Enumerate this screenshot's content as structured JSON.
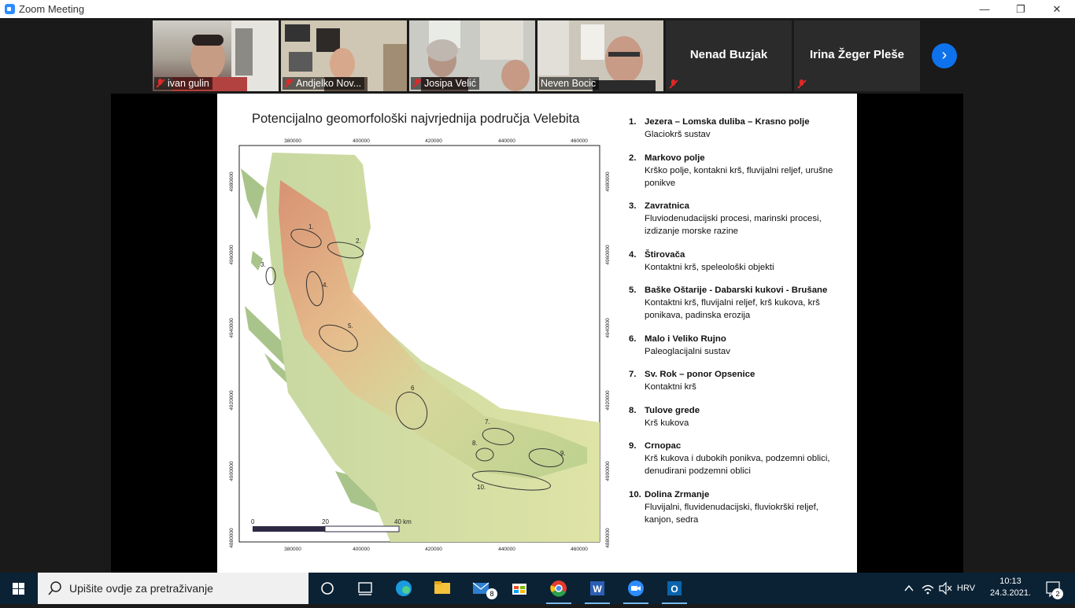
{
  "window": {
    "title": "Zoom Meeting",
    "minimize": "—",
    "restore": "❐",
    "close": "✕"
  },
  "participants": [
    {
      "name": "ivan gulin"
    },
    {
      "name": "Andjelko Nov..."
    },
    {
      "name": "Josipa Velić"
    },
    {
      "name": "Neven Bocic"
    },
    {
      "name": "Nenad Buzjak"
    },
    {
      "name": "Irina Žeger Pleše"
    }
  ],
  "next_page_glyph": "›",
  "slide": {
    "title": "Potencijalno geomorfološki najvrjednija područja Velebita",
    "map": {
      "x_ticks": [
        "380000",
        "400000",
        "420000",
        "440000",
        "460000"
      ],
      "y_ticks": [
        "4980000",
        "4960000",
        "4940000",
        "4920000",
        "4900000",
        "4880000"
      ],
      "site_labels": [
        "1.",
        "2.",
        "3.",
        "4.",
        "5.",
        "6",
        "7.",
        "8.",
        "9.",
        "10."
      ],
      "scale_labels": [
        "0",
        "20",
        "40 km"
      ]
    },
    "legend": [
      {
        "num": "1.",
        "title": "Jezera – Lomska duliba – Krasno polje",
        "desc": "Glaciokrš sustav"
      },
      {
        "num": "2.",
        "title": "Markovo polje",
        "desc": "Krško polje, kontakni krš, fluvijalni reljef, urušne ponikve"
      },
      {
        "num": "3.",
        "title": "Zavratnica",
        "desc": "Fluviodenudacijski procesi, marinski procesi, izdizanje morske razine"
      },
      {
        "num": "4.",
        "title": "Štirovača",
        "desc": "Kontaktni krš, speleološki objekti"
      },
      {
        "num": "5.",
        "title": "Baške Oštarije - Dabarski kukovi - Brušane",
        "desc": "Kontaktni krš, fluvijalni reljef, krš kukova, krš ponikava, padinska erozija"
      },
      {
        "num": "6.",
        "title": "Malo i Veliko Rujno",
        "desc": "Paleoglacijalni sustav"
      },
      {
        "num": "7.",
        "title": "Sv. Rok – ponor Opsenice",
        "desc": "Kontaktni krš"
      },
      {
        "num": "8.",
        "title": "Tulove grede",
        "desc": "Krš kukova"
      },
      {
        "num": "9.",
        "title": "Crnopac",
        "desc": "Krš kukova i dubokih ponikva, podzemni oblici, denudirani podzemni oblici"
      },
      {
        "num": "10.",
        "title": "Dolina Zrmanje",
        "desc": "Fluvijalni, fluvidenudacijski, fluviokrški reljef, kanjon, sedra"
      }
    ]
  },
  "taskbar": {
    "search_placeholder": "Upišite ovdje za pretraživanje",
    "mail_badge": "8",
    "language": "HRV",
    "time": "10:13",
    "date": "24.3.2021.",
    "notifications": "2"
  },
  "colors": {
    "zoom_blue": "#0e72ed",
    "active_speaker": "#a6d73b",
    "taskbar": "#0b2235"
  }
}
